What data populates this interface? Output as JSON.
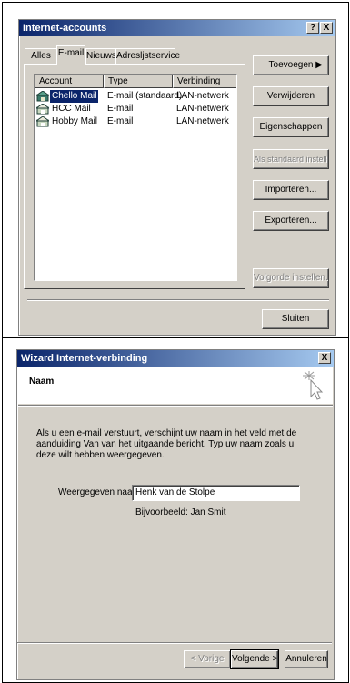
{
  "accounts_dialog": {
    "title": "Internet-accounts",
    "help_button": "?",
    "close_button": "X",
    "tabs": [
      "Alles",
      "E-mail",
      "Nieuws",
      "Adresljstservice"
    ],
    "active_tab": "E-mail",
    "columns": [
      "Account",
      "Type",
      "Verbinding"
    ],
    "rows": [
      {
        "account": "Chello Mail",
        "type": "E-mail (standaard)",
        "connection": "LAN-netwerk",
        "selected": true
      },
      {
        "account": "HCC Mail",
        "type": "E-mail",
        "connection": "LAN-netwerk",
        "selected": false
      },
      {
        "account": "Hobby Mail",
        "type": "E-mail",
        "connection": "LAN-netwerk",
        "selected": false
      }
    ],
    "buttons": {
      "add": "Toevoegen",
      "remove": "Verwijderen",
      "properties": "Eigenschappen",
      "set_default": "Als standaard instellen",
      "import": "Importeren...",
      "export": "Exporteren...",
      "order": "Volgorde instellen...",
      "close": "Sluiten"
    },
    "add_arrow_icon": "triangle-right-icon"
  },
  "wizard_dialog": {
    "title": "Wizard Internet-verbinding",
    "close_button": "X",
    "header_title": "Naam",
    "header_icon": "cursor-sparkle-icon",
    "description": "Als u een e-mail verstuurt, verschijnt uw naam in het veld met de aanduiding Van van het uitgaande bericht. Typ uw naam zoals u deze wilt hebben weergegeven.",
    "field_label": "Weergegeven naam:",
    "field_value": "Henk van de Stolpe",
    "example": "Bijvoorbeeld: Jan Smit",
    "buttons": {
      "back": "< Vorige",
      "next": "Volgende >",
      "cancel": "Annuleren"
    }
  },
  "colors": {
    "titlebar_start": "#0a246a",
    "titlebar_end": "#a6caf0",
    "dialog_face": "#d4d0c8",
    "selection": "#0a246a"
  }
}
